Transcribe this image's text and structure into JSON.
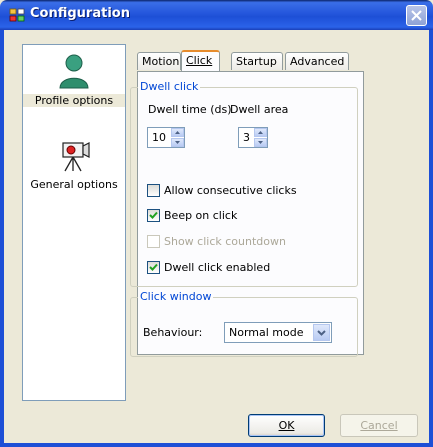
{
  "window": {
    "title": "Configuration"
  },
  "sidebar": {
    "items": [
      {
        "label": "Profile options",
        "icon": "profile-person-icon",
        "selected": true
      },
      {
        "label": "General options",
        "icon": "camera-icon",
        "selected": false
      }
    ]
  },
  "tabs": [
    {
      "label": "Motion",
      "active": false
    },
    {
      "label": "Click",
      "active": true
    },
    {
      "label": "Startup",
      "active": false
    },
    {
      "label": "Advanced",
      "active": false
    }
  ],
  "dwell_click": {
    "group_title": "Dwell click",
    "dwell_time_label": "Dwell time (ds)",
    "dwell_area_label": "Dwell area",
    "dwell_time_value": "10",
    "dwell_area_value": "3"
  },
  "checkboxes": [
    {
      "label": "Allow consecutive clicks",
      "checked": false,
      "enabled": true
    },
    {
      "label": "Beep on click",
      "checked": true,
      "enabled": true
    },
    {
      "label": "Show click countdown",
      "checked": false,
      "enabled": false
    },
    {
      "label": "Dwell click enabled",
      "checked": true,
      "enabled": true
    }
  ],
  "click_window": {
    "group_title": "Click window",
    "behaviour_label": "Behaviour:",
    "behaviour_value": "Normal mode"
  },
  "buttons": {
    "ok": "OK",
    "cancel": "Cancel"
  },
  "colors": {
    "title_bar": "#1d4fd6",
    "group_title": "#0046d5",
    "tab_highlight": "#e68b2c"
  }
}
